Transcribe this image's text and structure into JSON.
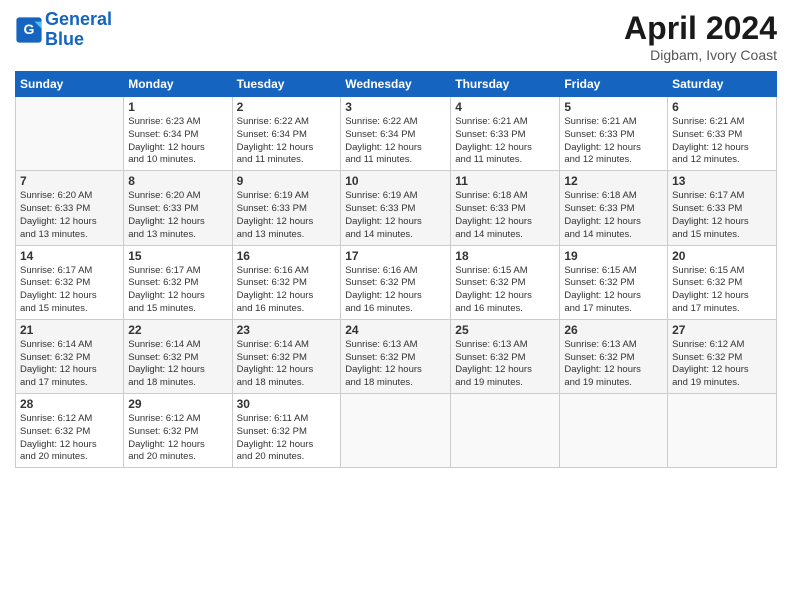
{
  "header": {
    "logo_line1": "General",
    "logo_line2": "Blue",
    "month": "April 2024",
    "location": "Digbam, Ivory Coast"
  },
  "days_of_week": [
    "Sunday",
    "Monday",
    "Tuesday",
    "Wednesday",
    "Thursday",
    "Friday",
    "Saturday"
  ],
  "weeks": [
    [
      {
        "day": "",
        "info": ""
      },
      {
        "day": "1",
        "info": "Sunrise: 6:23 AM\nSunset: 6:34 PM\nDaylight: 12 hours\nand 10 minutes."
      },
      {
        "day": "2",
        "info": "Sunrise: 6:22 AM\nSunset: 6:34 PM\nDaylight: 12 hours\nand 11 minutes."
      },
      {
        "day": "3",
        "info": "Sunrise: 6:22 AM\nSunset: 6:34 PM\nDaylight: 12 hours\nand 11 minutes."
      },
      {
        "day": "4",
        "info": "Sunrise: 6:21 AM\nSunset: 6:33 PM\nDaylight: 12 hours\nand 11 minutes."
      },
      {
        "day": "5",
        "info": "Sunrise: 6:21 AM\nSunset: 6:33 PM\nDaylight: 12 hours\nand 12 minutes."
      },
      {
        "day": "6",
        "info": "Sunrise: 6:21 AM\nSunset: 6:33 PM\nDaylight: 12 hours\nand 12 minutes."
      }
    ],
    [
      {
        "day": "7",
        "info": "Sunrise: 6:20 AM\nSunset: 6:33 PM\nDaylight: 12 hours\nand 13 minutes."
      },
      {
        "day": "8",
        "info": "Sunrise: 6:20 AM\nSunset: 6:33 PM\nDaylight: 12 hours\nand 13 minutes."
      },
      {
        "day": "9",
        "info": "Sunrise: 6:19 AM\nSunset: 6:33 PM\nDaylight: 12 hours\nand 13 minutes."
      },
      {
        "day": "10",
        "info": "Sunrise: 6:19 AM\nSunset: 6:33 PM\nDaylight: 12 hours\nand 14 minutes."
      },
      {
        "day": "11",
        "info": "Sunrise: 6:18 AM\nSunset: 6:33 PM\nDaylight: 12 hours\nand 14 minutes."
      },
      {
        "day": "12",
        "info": "Sunrise: 6:18 AM\nSunset: 6:33 PM\nDaylight: 12 hours\nand 14 minutes."
      },
      {
        "day": "13",
        "info": "Sunrise: 6:17 AM\nSunset: 6:33 PM\nDaylight: 12 hours\nand 15 minutes."
      }
    ],
    [
      {
        "day": "14",
        "info": "Sunrise: 6:17 AM\nSunset: 6:32 PM\nDaylight: 12 hours\nand 15 minutes."
      },
      {
        "day": "15",
        "info": "Sunrise: 6:17 AM\nSunset: 6:32 PM\nDaylight: 12 hours\nand 15 minutes."
      },
      {
        "day": "16",
        "info": "Sunrise: 6:16 AM\nSunset: 6:32 PM\nDaylight: 12 hours\nand 16 minutes."
      },
      {
        "day": "17",
        "info": "Sunrise: 6:16 AM\nSunset: 6:32 PM\nDaylight: 12 hours\nand 16 minutes."
      },
      {
        "day": "18",
        "info": "Sunrise: 6:15 AM\nSunset: 6:32 PM\nDaylight: 12 hours\nand 16 minutes."
      },
      {
        "day": "19",
        "info": "Sunrise: 6:15 AM\nSunset: 6:32 PM\nDaylight: 12 hours\nand 17 minutes."
      },
      {
        "day": "20",
        "info": "Sunrise: 6:15 AM\nSunset: 6:32 PM\nDaylight: 12 hours\nand 17 minutes."
      }
    ],
    [
      {
        "day": "21",
        "info": "Sunrise: 6:14 AM\nSunset: 6:32 PM\nDaylight: 12 hours\nand 17 minutes."
      },
      {
        "day": "22",
        "info": "Sunrise: 6:14 AM\nSunset: 6:32 PM\nDaylight: 12 hours\nand 18 minutes."
      },
      {
        "day": "23",
        "info": "Sunrise: 6:14 AM\nSunset: 6:32 PM\nDaylight: 12 hours\nand 18 minutes."
      },
      {
        "day": "24",
        "info": "Sunrise: 6:13 AM\nSunset: 6:32 PM\nDaylight: 12 hours\nand 18 minutes."
      },
      {
        "day": "25",
        "info": "Sunrise: 6:13 AM\nSunset: 6:32 PM\nDaylight: 12 hours\nand 19 minutes."
      },
      {
        "day": "26",
        "info": "Sunrise: 6:13 AM\nSunset: 6:32 PM\nDaylight: 12 hours\nand 19 minutes."
      },
      {
        "day": "27",
        "info": "Sunrise: 6:12 AM\nSunset: 6:32 PM\nDaylight: 12 hours\nand 19 minutes."
      }
    ],
    [
      {
        "day": "28",
        "info": "Sunrise: 6:12 AM\nSunset: 6:32 PM\nDaylight: 12 hours\nand 20 minutes."
      },
      {
        "day": "29",
        "info": "Sunrise: 6:12 AM\nSunset: 6:32 PM\nDaylight: 12 hours\nand 20 minutes."
      },
      {
        "day": "30",
        "info": "Sunrise: 6:11 AM\nSunset: 6:32 PM\nDaylight: 12 hours\nand 20 minutes."
      },
      {
        "day": "",
        "info": ""
      },
      {
        "day": "",
        "info": ""
      },
      {
        "day": "",
        "info": ""
      },
      {
        "day": "",
        "info": ""
      }
    ]
  ]
}
